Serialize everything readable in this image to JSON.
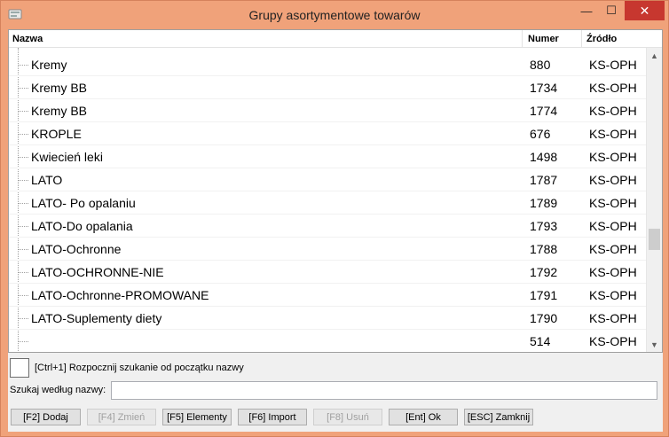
{
  "window": {
    "title": "Grupy asortymentowe towarów",
    "minimize_glyph": "—",
    "maximize_glyph": "☐",
    "close_glyph": "✕",
    "accent": "#f0a27a",
    "close_color": "#c7372f"
  },
  "table": {
    "columns": {
      "name": "Nazwa",
      "number": "Numer",
      "source": "Źródło"
    },
    "rows": [
      {
        "name": "Kremy",
        "number": "880",
        "source": "KS-OPH"
      },
      {
        "name": "Kremy BB",
        "number": "1734",
        "source": "KS-OPH"
      },
      {
        "name": "Kremy BB",
        "number": "1774",
        "source": "KS-OPH"
      },
      {
        "name": "KROPLE",
        "number": "676",
        "source": "KS-OPH"
      },
      {
        "name": "Kwiecień leki",
        "number": "1498",
        "source": "KS-OPH"
      },
      {
        "name": "LATO",
        "number": "1787",
        "source": "KS-OPH"
      },
      {
        "name": "LATO- Po opalaniu",
        "number": "1789",
        "source": "KS-OPH"
      },
      {
        "name": "LATO-Do opalania",
        "number": "1793",
        "source": "KS-OPH"
      },
      {
        "name": "LATO-Ochronne",
        "number": "1788",
        "source": "KS-OPH"
      },
      {
        "name": "LATO-OCHRONNE-NIE",
        "number": "1792",
        "source": "KS-OPH"
      },
      {
        "name": "LATO-Ochronne-PROMOWANE",
        "number": "1791",
        "source": "KS-OPH"
      },
      {
        "name": "LATO-Suplementy diety",
        "number": "1790",
        "source": "KS-OPH"
      },
      {
        "name": "",
        "number": "514",
        "source": "KS-OPH"
      }
    ]
  },
  "search": {
    "checkbox_label": "[Ctrl+1] Rozpocznij szukanie od początku nazwy",
    "label": "Szukaj według nazwy:",
    "value": ""
  },
  "buttons": {
    "add": "[F2] Dodaj",
    "edit": "[F4] Zmień",
    "elements": "[F5] Elementy",
    "import": "[F6] Import",
    "delete": "[F8] Usuń",
    "ok": "[Ent] Ok",
    "close": "[ESC] Zamknij"
  }
}
